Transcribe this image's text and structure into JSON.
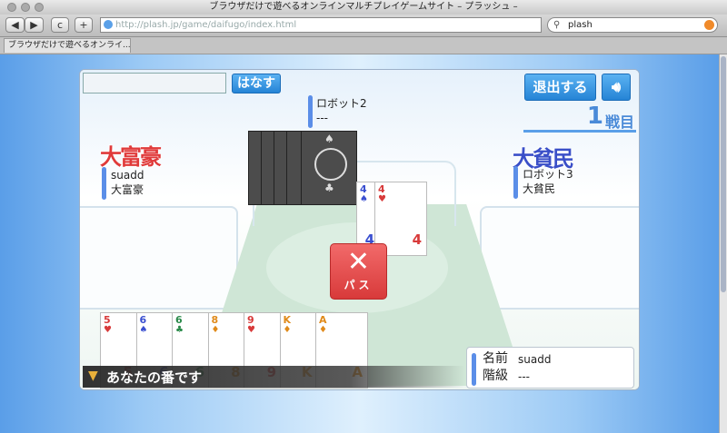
{
  "browser": {
    "title": "ブラウザだけで遊べるオンラインマルチプレイゲームサイト – プラッシュ –",
    "back_label": "◀",
    "forward_label": "▶",
    "reload_label": "c",
    "add_label": "+",
    "url": "http://plash.jp/game/daifugo/index.html",
    "search_value": "plash",
    "tab_label": "ブラウザだけで遊べるオンライ..."
  },
  "game": {
    "talk_button": "はなす",
    "exit_button": "退出する",
    "round_number": "1",
    "round_suffix": "戦目",
    "pass_label": "パス",
    "turn_message": "あなたの番です",
    "players": {
      "top": {
        "name": "ロボット2",
        "rank": "---"
      },
      "left": {
        "title": "大富豪",
        "name": "suadd",
        "rank": "大富豪"
      },
      "right": {
        "title": "大貧民",
        "name": "ロボット3",
        "rank": "大貧民"
      }
    },
    "self_panel": {
      "name_label": "名前",
      "name_value": "suadd",
      "rank_label": "階級",
      "rank_value": "---"
    },
    "played_cards": [
      {
        "rank": "4",
        "suit": "♠",
        "color": "#3a4fd0"
      },
      {
        "rank": "4",
        "suit": "♥",
        "color": "#d83a3a"
      }
    ],
    "hand": [
      {
        "rank": "5",
        "suit": "♥",
        "color": "#d83a3a"
      },
      {
        "rank": "6",
        "suit": "♠",
        "color": "#3a4fd0"
      },
      {
        "rank": "6",
        "suit": "♣",
        "color": "#2a8a4a"
      },
      {
        "rank": "8",
        "suit": "♦",
        "color": "#e08a1a"
      },
      {
        "rank": "9",
        "suit": "♥",
        "color": "#d83a3a"
      },
      {
        "rank": "K",
        "suit": "♦",
        "color": "#e08a1a"
      },
      {
        "rank": "A",
        "suit": "♦",
        "color": "#e08a1a"
      }
    ],
    "colors": {
      "accent_blue": "#2584d6",
      "daifugo_red": "#e03a3a",
      "daihinmin_blue": "#3a4fc8",
      "pass_red": "#e0484a"
    }
  }
}
